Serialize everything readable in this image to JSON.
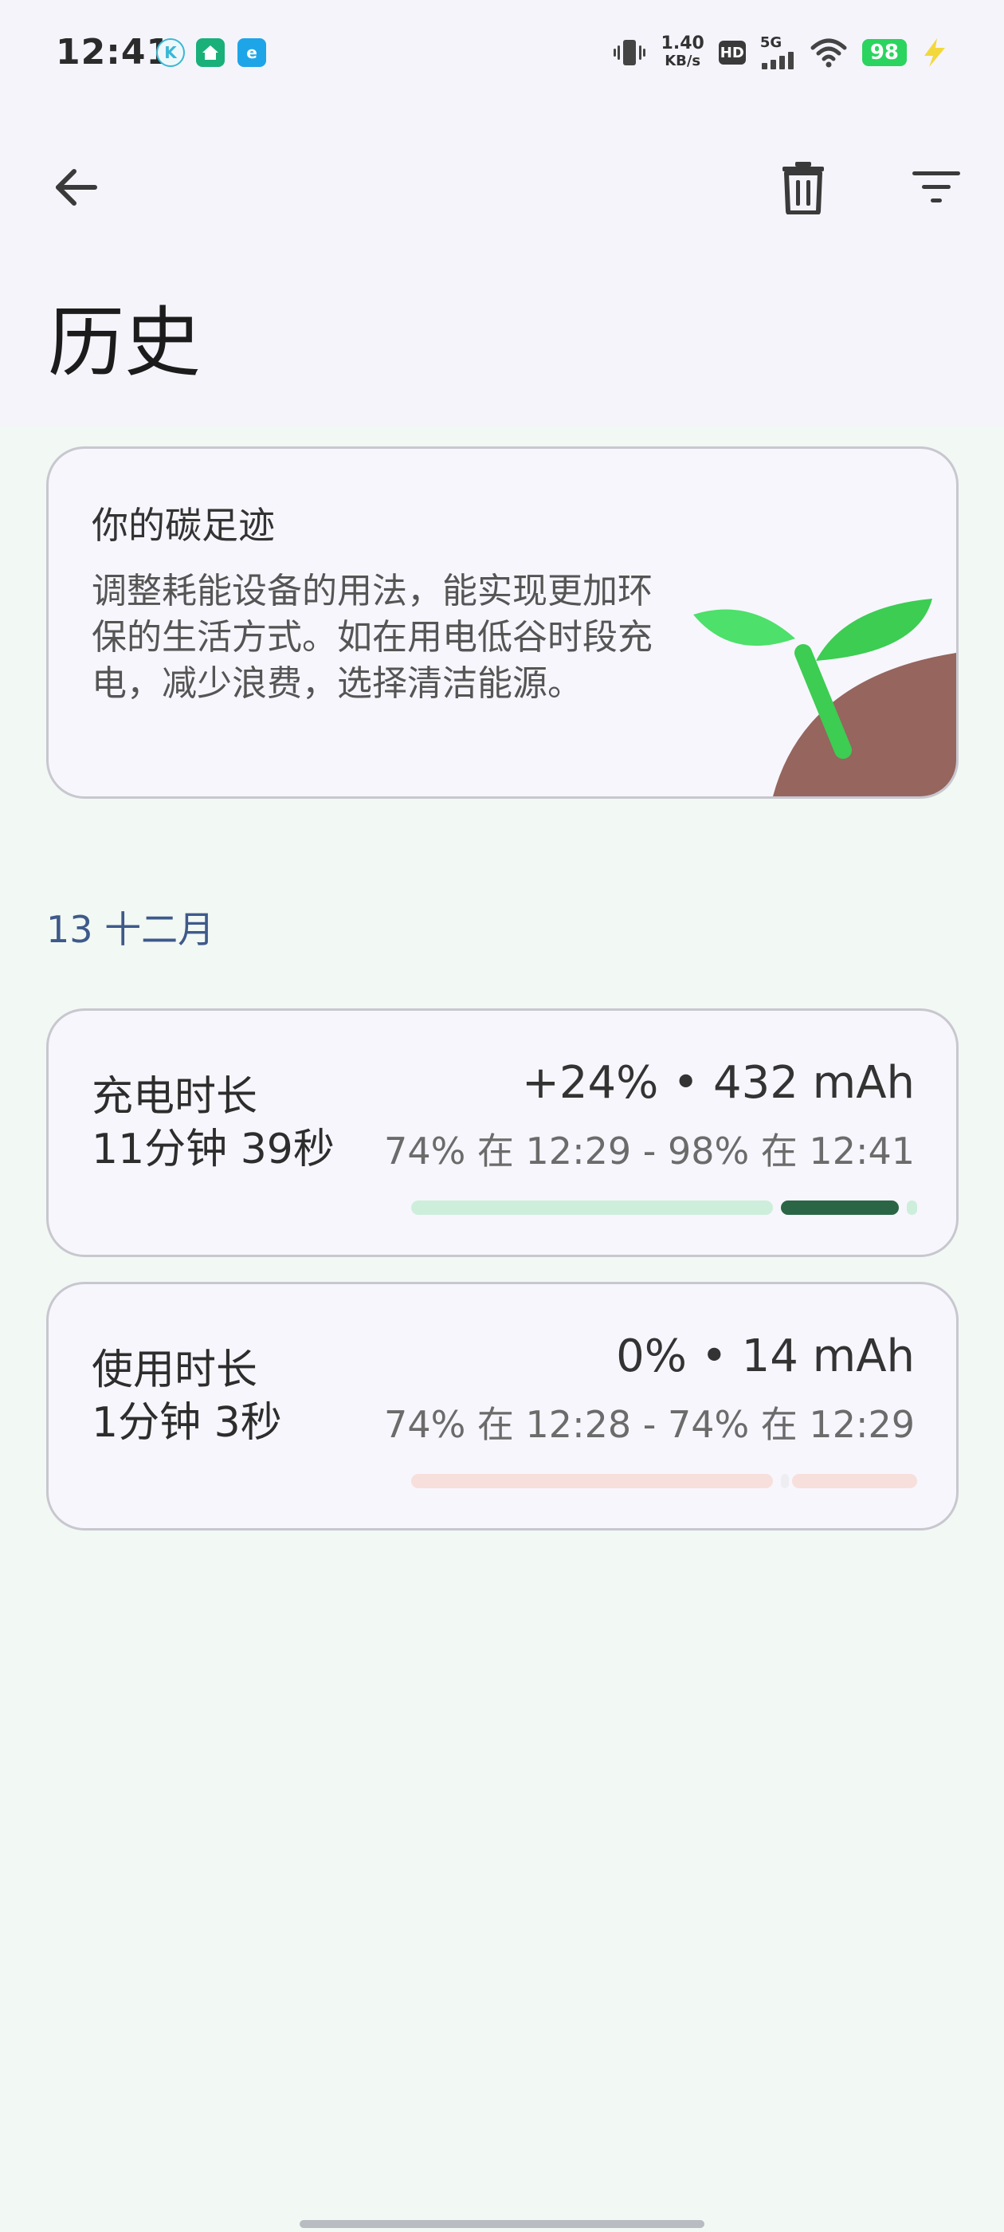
{
  "status_bar": {
    "time": "12:41",
    "net_speed_value": "1.40",
    "net_speed_unit": "KB/s",
    "hd": "HD",
    "network": "5G",
    "battery": "98"
  },
  "app_bar": {
    "back_icon": "arrow-left-icon",
    "delete_icon": "trash-icon",
    "filter_icon": "filter-icon"
  },
  "page": {
    "title": "历史"
  },
  "carbon_card": {
    "title": "你的碳足迹",
    "body": "调整耗能设备的用法，能实现更加环保的生活方式。如在用电低谷时段充电，减少浪费，选择清洁能源。"
  },
  "date_header": "13 十二月",
  "sessions": [
    {
      "type": "充电时长",
      "duration": "11分钟 39秒",
      "metric": "+24% • 432 mAh",
      "range": "74% 在 12:29 - 98% 在 12:41"
    },
    {
      "type": "使用时长",
      "duration": "1分钟 3秒",
      "metric": "0% • 14 mAh",
      "range": "74% 在 12:28 - 74% 在 12:29"
    }
  ],
  "colors": {
    "charge_light": "#cdeedb",
    "charge_dark": "#2a6645",
    "use_light": "#f7dfdc",
    "accent_blue": "#3e5a8a"
  }
}
